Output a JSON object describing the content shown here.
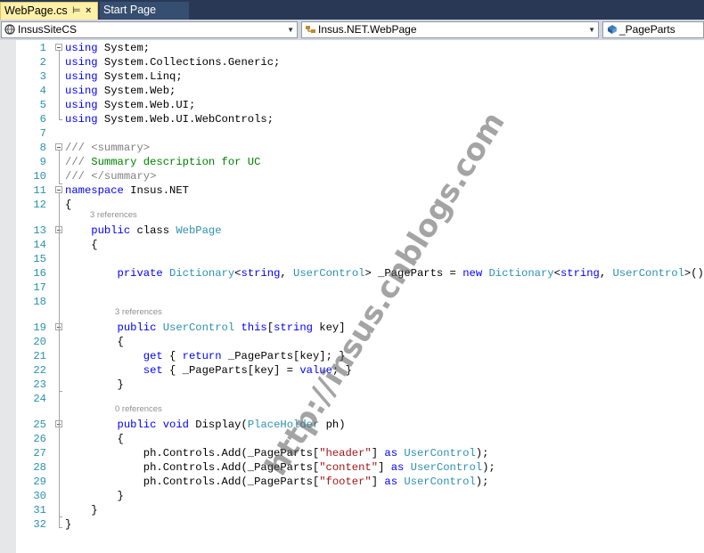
{
  "tabs": [
    {
      "label": "WebPage.cs",
      "active": true,
      "pin_glyph": "⊨",
      "close_glyph": "×"
    },
    {
      "label": "Start Page",
      "active": false
    }
  ],
  "navbar": {
    "project": "InsusSiteCS",
    "type": "Insus.NET.WebPage",
    "member": "_PageParts"
  },
  "code_lens": [
    {
      "text": "3 references"
    },
    {
      "text": "3 references"
    },
    {
      "text": "0 references"
    }
  ],
  "code_lines": [
    {
      "n": "1",
      "t": [
        [
          "kw",
          "using"
        ],
        [
          "",
          "System;"
        ]
      ]
    },
    {
      "n": "2",
      "t": [
        [
          "kw",
          "using"
        ],
        [
          "",
          "System.Collections.Generic;"
        ]
      ]
    },
    {
      "n": "3",
      "t": [
        [
          "kw",
          "using"
        ],
        [
          "",
          "System.Linq;"
        ]
      ]
    },
    {
      "n": "4",
      "t": [
        [
          "kw",
          "using"
        ],
        [
          "",
          "System.Web;"
        ]
      ]
    },
    {
      "n": "5",
      "t": [
        [
          "kw",
          "using"
        ],
        [
          "",
          "System.Web.UI;"
        ]
      ]
    },
    {
      "n": "6",
      "t": [
        [
          "kw",
          "using"
        ],
        [
          "",
          "System.Web.UI.WebControls;"
        ]
      ]
    },
    {
      "n": "7",
      "t": []
    },
    {
      "n": "8",
      "t": [
        [
          "dc",
          "/// <summary>"
        ]
      ]
    },
    {
      "n": "9",
      "t": [
        [
          "dc",
          "/// "
        ],
        [
          "cm",
          "Summary description for UC"
        ]
      ]
    },
    {
      "n": "10",
      "t": [
        [
          "dc",
          "/// </summary>"
        ]
      ]
    },
    {
      "n": "11",
      "t": [
        [
          "kw",
          "namespace"
        ],
        [
          "",
          "Insus.NET"
        ]
      ]
    },
    {
      "n": "12",
      "t": [
        [
          "",
          "{"
        ]
      ]
    },
    {
      "n": "13",
      "t": [
        [
          "",
          "    "
        ],
        [
          "kw",
          "public"
        ],
        [
          "",
          "class"
        ],
        [
          "ty",
          "WebPage"
        ]
      ]
    },
    {
      "n": "14",
      "t": [
        [
          "",
          "    {"
        ]
      ]
    },
    {
      "n": "15",
      "t": []
    },
    {
      "n": "16",
      "t": [
        [
          "",
          "        "
        ],
        [
          "kw",
          "private"
        ],
        [
          "ty",
          "Dictionary"
        ],
        [
          "",
          "<"
        ],
        [
          "kw",
          "string"
        ],
        [
          "",
          ", "
        ],
        [
          "ty",
          "UserControl"
        ],
        [
          "",
          "> _PageParts = "
        ],
        [
          "kw",
          "new"
        ],
        [
          "ty",
          "Dictionary"
        ],
        [
          "",
          "<"
        ],
        [
          "kw",
          "string"
        ],
        [
          "",
          ", "
        ],
        [
          "ty",
          "UserControl"
        ],
        [
          "",
          ">();"
        ]
      ]
    },
    {
      "n": "17",
      "t": []
    },
    {
      "n": "18",
      "t": []
    },
    {
      "n": "19",
      "t": [
        [
          "",
          "        "
        ],
        [
          "kw",
          "public"
        ],
        [
          "ty",
          "UserControl"
        ],
        [
          "kw",
          "this"
        ],
        [
          "",
          "["
        ],
        [
          "kw",
          "string"
        ],
        [
          "",
          "key]"
        ]
      ]
    },
    {
      "n": "20",
      "t": [
        [
          "",
          "        {"
        ]
      ]
    },
    {
      "n": "21",
      "t": [
        [
          "",
          "            "
        ],
        [
          "kw",
          "get"
        ],
        [
          "",
          "{ "
        ],
        [
          "kw",
          "return"
        ],
        [
          "",
          "_PageParts[key]; }"
        ]
      ]
    },
    {
      "n": "22",
      "t": [
        [
          "",
          "            "
        ],
        [
          "kw",
          "set"
        ],
        [
          "",
          "{ _PageParts[key] = "
        ],
        [
          "kw",
          "value"
        ],
        [
          "",
          "; }"
        ]
      ]
    },
    {
      "n": "23",
      "t": [
        [
          "",
          "        }"
        ]
      ]
    },
    {
      "n": "24",
      "t": []
    },
    {
      "n": "25",
      "t": [
        [
          "",
          "        "
        ],
        [
          "kw",
          "public"
        ],
        [
          "kw",
          "void"
        ],
        [
          "",
          "Display("
        ],
        [
          "ty",
          "PlaceHolder"
        ],
        [
          "",
          "ph)"
        ]
      ]
    },
    {
      "n": "26",
      "t": [
        [
          "",
          "        {"
        ]
      ]
    },
    {
      "n": "27",
      "t": [
        [
          "",
          "            ph.Controls.Add(_PageParts["
        ],
        [
          "st",
          "\"header\""
        ],
        [
          "",
          "] "
        ],
        [
          "kw",
          "as"
        ],
        [
          "ty",
          "UserControl"
        ],
        [
          "",
          ");"
        ]
      ]
    },
    {
      "n": "28",
      "t": [
        [
          "",
          "            ph.Controls.Add(_PageParts["
        ],
        [
          "st",
          "\"content\""
        ],
        [
          "",
          "] "
        ],
        [
          "kw",
          "as"
        ],
        [
          "ty",
          "UserControl"
        ],
        [
          "",
          ");"
        ]
      ]
    },
    {
      "n": "29",
      "t": [
        [
          "",
          "            ph.Controls.Add(_PageParts["
        ],
        [
          "st",
          "\"footer\""
        ],
        [
          "",
          "] "
        ],
        [
          "kw",
          "as"
        ],
        [
          "ty",
          "UserControl"
        ],
        [
          "",
          ");"
        ]
      ]
    },
    {
      "n": "30",
      "t": [
        [
          "",
          "        }"
        ]
      ]
    },
    {
      "n": "31",
      "t": [
        [
          "",
          "    }"
        ]
      ]
    },
    {
      "n": "32",
      "t": [
        [
          "",
          "}"
        ]
      ]
    }
  ],
  "watermark": "http://insus.cnblogs.com",
  "colors": {
    "keyword": "#0000ff",
    "type": "#2b91af",
    "comment": "#008000",
    "doc_comment": "#808080",
    "string": "#a31515",
    "line_number": "#2b91af",
    "tab_active": "#fff1a8",
    "tab_strip": "#293955"
  },
  "icons": {
    "project": "csharp-project-icon",
    "type": "class-icon",
    "member": "field-icon"
  }
}
